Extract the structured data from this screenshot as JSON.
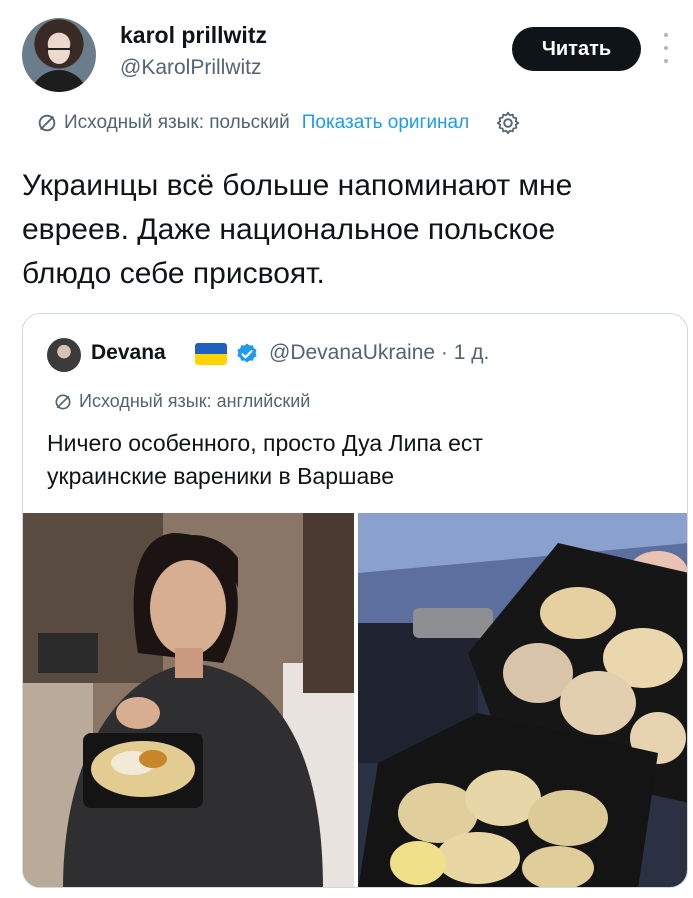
{
  "author": {
    "name": "karol prillwitz",
    "handle": "@KarolPrillwitz"
  },
  "actions": {
    "read_label": "Читать"
  },
  "translation": {
    "source_language": "Исходный язык: польский",
    "show_original": "Показать оригинал"
  },
  "tweet": {
    "text": "Украинцы всё больше напоминают мне\nевреев. Даже национальное польское\nблюдо себе присвоят."
  },
  "quote": {
    "name": "Devana",
    "handle": "@DevanaUkraine",
    "time": "· 1 д.",
    "source_language": "Исходный язык: английский",
    "text": "Ничего особенного, просто Дуа Липа ест\nукраинские вареники в Варшаве"
  },
  "colors": {
    "accent": "#1d9bf0",
    "text_primary": "#0f1419",
    "text_secondary": "#536471",
    "button_bg": "#0f1419",
    "border": "#cfd9de",
    "flag_blue": "#1f5fbf",
    "flag_yellow": "#ffd400"
  },
  "icons": {
    "translate": "translate-icon",
    "settings": "gear-icon",
    "more": "more-vertical-icon",
    "verified": "verified-badge-icon"
  }
}
